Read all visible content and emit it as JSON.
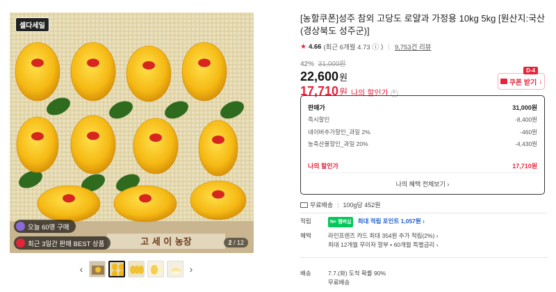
{
  "gallery": {
    "badge": "셀다세일",
    "overlay_today": "오늘 60명 구매",
    "overlay_best": "최근 3일간 판매 BEST 상품",
    "counter_current": "2",
    "counter_total": "12",
    "prev_arrow": "‹",
    "next_arrow": "›"
  },
  "product": {
    "title": "[농할쿠폰]성주 참외 고당도 로얄과 가정용 10kg 5kg [원산지:국산(경상북도 성주군)]",
    "rating_star": "★",
    "rating": "4.66",
    "rating_recent": "(최근 6개월 4.73",
    "rating_info_icon": "ⓘ",
    "rating_recent_close": ")",
    "review_count": "9,753건 리뷰"
  },
  "price": {
    "discount_rate": "42%",
    "original": "31,000원",
    "sale": "22,600",
    "won": "원",
    "my_price": "17,710",
    "my_price_won": "원",
    "my_price_label": "나의 할인가",
    "caret": "^"
  },
  "coupon": {
    "tag": "D-4",
    "label": "쿠폰 받기",
    "arrow": "↓"
  },
  "breakdown": {
    "rows": [
      {
        "label": "판매가",
        "value": "31,000원"
      },
      {
        "label": "즉시할인",
        "value": "-8,400원"
      },
      {
        "label": "네이버추가할인_과일 2%",
        "value": "-460원"
      },
      {
        "label": "농축산물할인_과일 20%",
        "value": "-4,430원"
      }
    ],
    "mine_label": "나의 할인가",
    "mine_value": "17,710원",
    "view_all": "나의 혜택 전체보기 ›"
  },
  "shipping": {
    "free": "무료배송",
    "per_unit": "100g당 452원"
  },
  "points": {
    "key": "적립",
    "npay_label": "N+ 멤버십",
    "text": "최대 적립 포인트 1,057원 ›"
  },
  "benefits": {
    "key": "혜택",
    "line1": "라인프렌즈 카드 최대 354원 추가 적립(2%) ›",
    "line2": "최대 12개월 무이자 할부 • 60개월 특별금리 ›"
  },
  "delivery": {
    "key": "배송",
    "line1": "7.7.(화) 도착 확률 90%",
    "line2": "무료배송"
  },
  "colors": {
    "accent_red": "#e5243b",
    "npay_green": "#03c75a",
    "melon_yellow": "#f6c21a"
  }
}
